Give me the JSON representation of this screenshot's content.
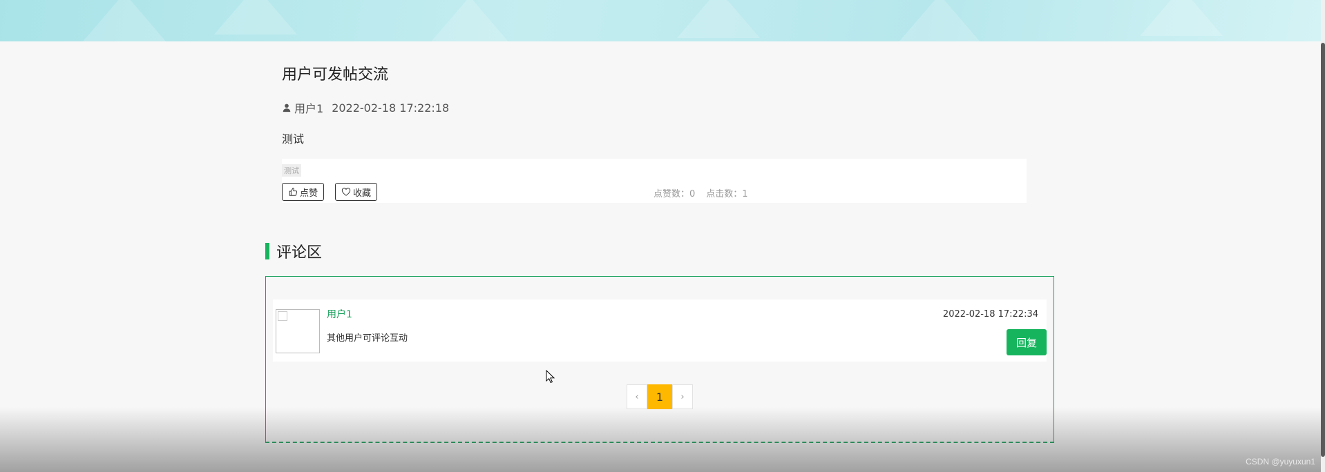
{
  "post": {
    "title": "用户可发帖交流",
    "author": "用户1",
    "date": "2022-02-18 17:22:18",
    "content": "测试",
    "tag": "测试",
    "like_label": "点赞",
    "favorite_label": "收藏",
    "like_count_text": "点赞数：0",
    "click_count_text": "点击数：1"
  },
  "comments_section": {
    "title": "评论区",
    "items": [
      {
        "user": "用户1",
        "text": "其他用户可评论互动",
        "date": "2022-02-18 17:22:34",
        "reply_label": "回复"
      }
    ],
    "pagination": {
      "prev": "‹",
      "current": "1",
      "next": "›"
    }
  },
  "watermark": "CSDN @yuyuxun1",
  "colors": {
    "accent_green": "#17b45e",
    "pager_active": "#ffb800"
  }
}
